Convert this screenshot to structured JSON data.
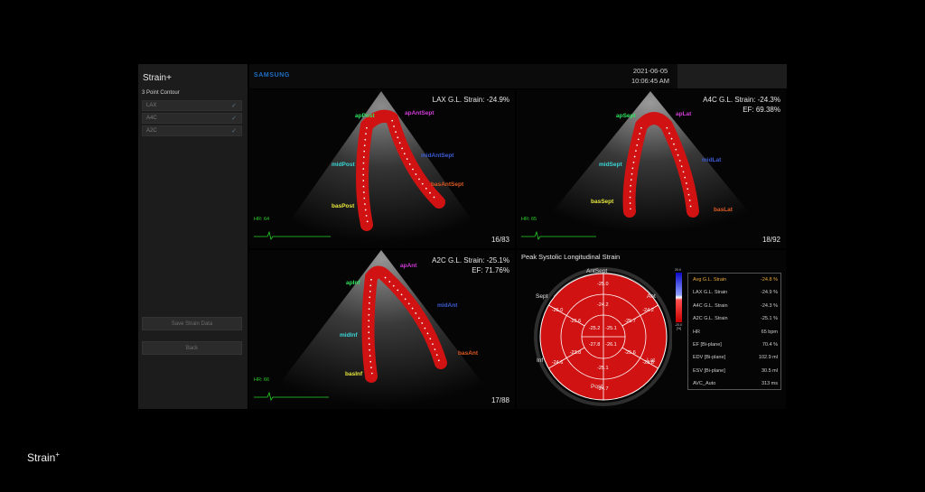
{
  "sidebar": {
    "title": "Strain+",
    "subtitle": "3 Point Contour",
    "items": [
      {
        "label": "LAX",
        "check": "✓"
      },
      {
        "label": "A4C",
        "check": "✓"
      },
      {
        "label": "A2C",
        "check": "✓"
      }
    ],
    "save_label": "Save Strain Data",
    "back_label": "Back"
  },
  "header": {
    "brand": "SAMSUNG",
    "date": "2021-06-05",
    "time": "10:06:45 AM"
  },
  "views": {
    "lax": {
      "strain": "LAX G.L. Strain: -24.9%",
      "frame": "16/83",
      "hr": "HR: 64",
      "labels": {
        "apPost": "apPost",
        "apAntSept": "apAntSept",
        "midAntSept": "midAntSept",
        "midPost": "midPost",
        "basAntSept": "basAntSept",
        "basPost": "basPost"
      }
    },
    "a4c": {
      "strain": "A4C G.L. Strain: -24.3%",
      "ef": "EF: 69.38%",
      "frame": "18/92",
      "hr": "HR: 65",
      "labels": {
        "apSept": "apSept",
        "apLat": "apLat",
        "midSept": "midSept",
        "midLat": "midLat",
        "basSept": "basSept",
        "basLat": "basLat"
      }
    },
    "a2c": {
      "strain": "A2C G.L. Strain: -25.1%",
      "ef": "EF: 71.76%",
      "frame": "17/88",
      "hr": "HR: 66",
      "labels": {
        "apAnt": "apAnt",
        "apInf": "apInf",
        "midAnt": "midAnt",
        "midInf": "midInf",
        "basAnt": "basAnt",
        "basInf": "basInf"
      }
    }
  },
  "bullseye": {
    "title": "Peak Systolic Longitudinal Strain",
    "labels": {
      "top": "AntSept",
      "left_top": "Sept",
      "right_top": "Ant",
      "left_bottom": "Inf",
      "right_bottom": "Lat",
      "bottom": "Post"
    },
    "scale_top": "20.0",
    "scale_bottom": "-20.0",
    "scale_unit": "[%]",
    "segments": {
      "outer": [
        "-25.0",
        "-24.2",
        "-23.8",
        "-24.7",
        "-24.6",
        "-26.0"
      ],
      "mid": [
        "-24.2",
        "-25.7",
        "-25.6",
        "-25.1",
        "-23.8",
        "-25.6"
      ],
      "inner": [
        "-25.2",
        "-25.1",
        "-26.1",
        "-27.8"
      ]
    }
  },
  "stats": [
    {
      "key": "Avg G.L. Strain",
      "value": "-24.8 %",
      "highlight": true
    },
    {
      "key": "LAX G.L. Strain",
      "value": "-24.9 %"
    },
    {
      "key": "A4C G.L. Strain",
      "value": "-24.3 %"
    },
    {
      "key": "A2C G.L. Strain",
      "value": "-25.1 %"
    },
    {
      "key": "HR",
      "value": "65 bpm"
    },
    {
      "key": "EF [Bi-plane]",
      "value": "70.4 %"
    },
    {
      "key": "EDV [Bi-plane]",
      "value": "102.9 ml"
    },
    {
      "key": "ESV [Bi-plane]",
      "value": "30.5 ml"
    },
    {
      "key": "AVC_Auto",
      "value": "313 ms"
    }
  ],
  "footer": {
    "logo": "Strain",
    "logo_sup": "+"
  },
  "colors": {
    "segment_red": "#d01212",
    "hr_green": "#28d228",
    "brand_blue": "#1e6fc6",
    "highlight": "#e7a83a"
  }
}
